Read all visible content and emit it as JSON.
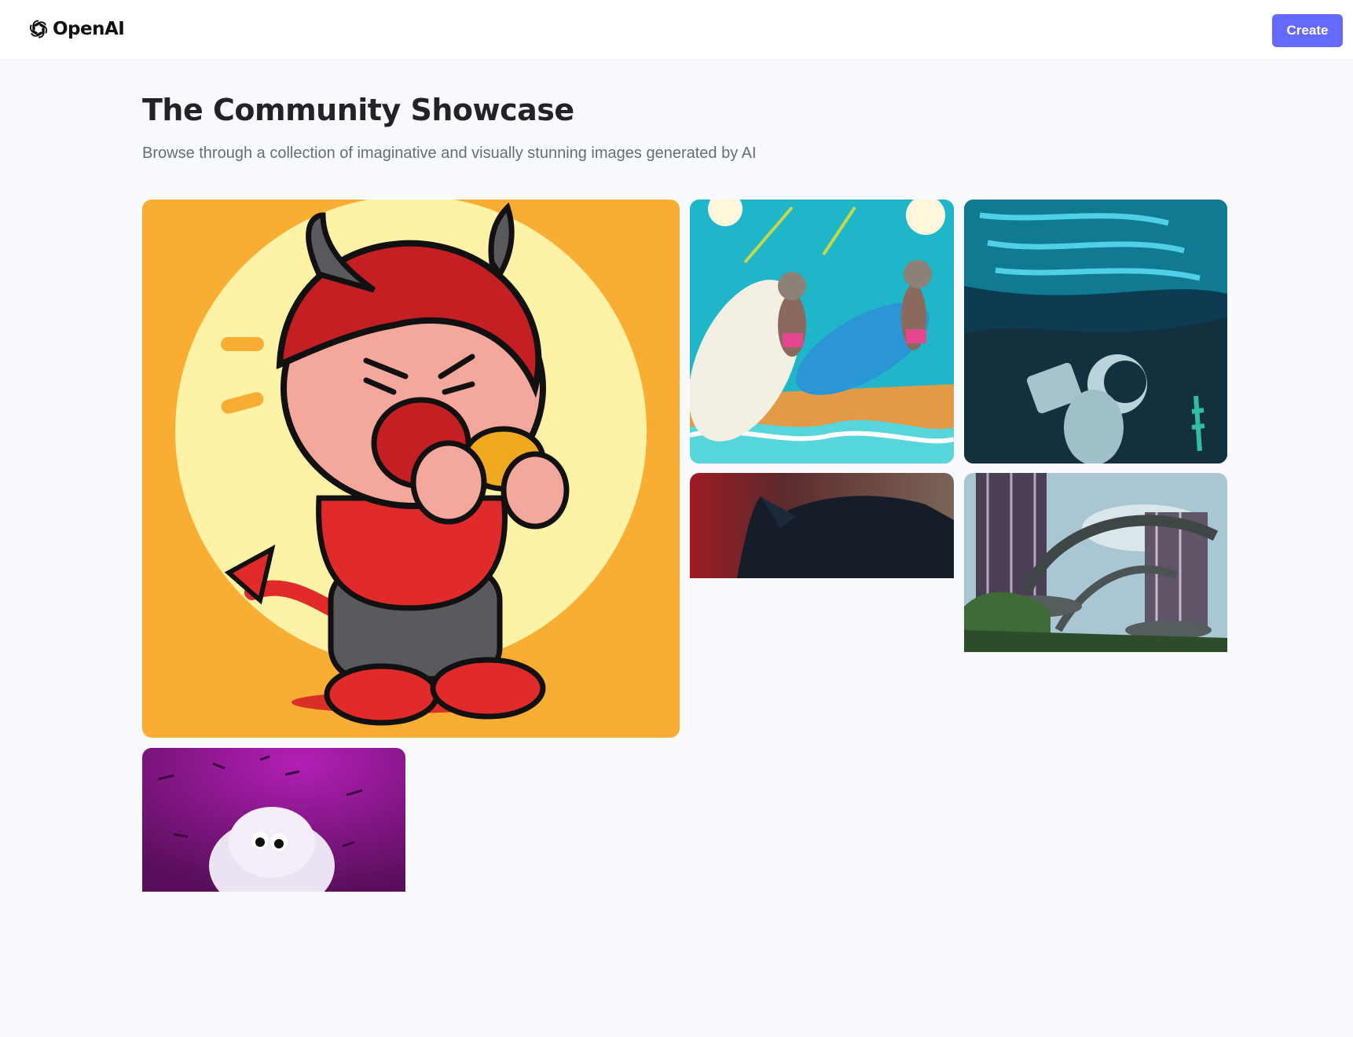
{
  "header": {
    "logo_text": "OpenAI",
    "logo_icon": "openai-logo-icon",
    "create_label": "Create"
  },
  "main": {
    "title": "The Community Showcase",
    "subtitle": "Browse through a collection of imaginative and visually stunning images generated by AI"
  },
  "gallery": [
    {
      "name": "devil-eating-donut-image"
    },
    {
      "name": "mice-surfing-beach-image"
    },
    {
      "name": "astronaut-underwater-image"
    },
    {
      "name": "black-cat-image"
    },
    {
      "name": "futuristic-towers-image"
    },
    {
      "name": "white-furry-monster-image"
    }
  ],
  "colors": {
    "accent": "#6469ff",
    "title": "#222328",
    "subtitle": "#666e75",
    "background": "#f9fafe"
  }
}
